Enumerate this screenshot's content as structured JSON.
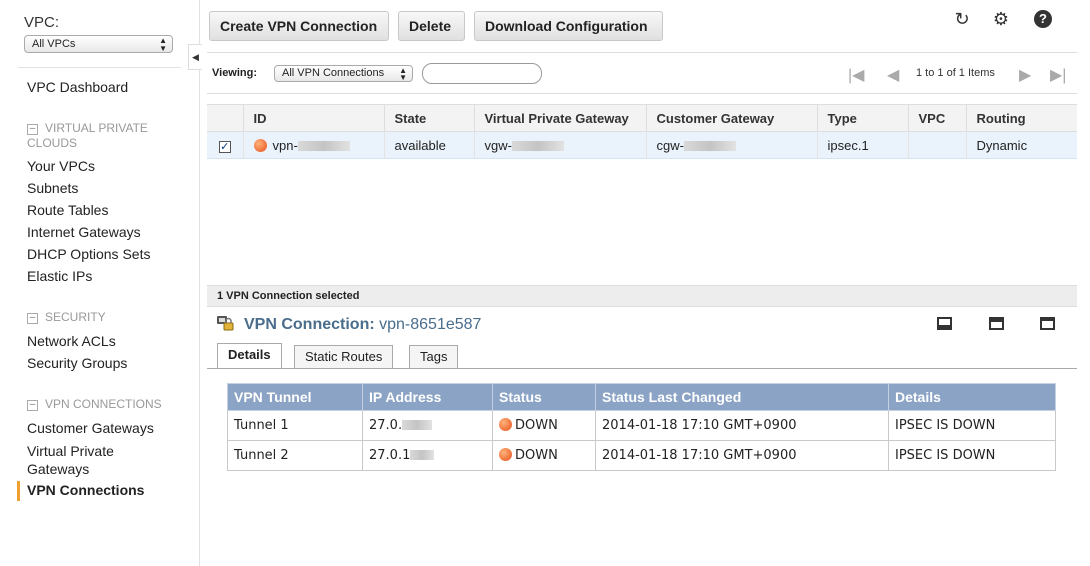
{
  "sidebar": {
    "vpc_label": "VPC:",
    "vpc_select": "All VPCs",
    "dashboard": "VPC Dashboard",
    "sections": [
      {
        "title": "VIRTUAL PRIVATE CLOUDS",
        "items": [
          "Your VPCs",
          "Subnets",
          "Route Tables",
          "Internet Gateways",
          "DHCP Options Sets",
          "Elastic IPs"
        ]
      },
      {
        "title": "SECURITY",
        "items": [
          "Network ACLs",
          "Security Groups"
        ]
      },
      {
        "title": "VPN CONNECTIONS",
        "items": [
          "Customer Gateways",
          "Virtual Private Gateways",
          "VPN Connections"
        ]
      }
    ],
    "active_item": "VPN Connections"
  },
  "toolbar": {
    "create": "Create VPN Connection",
    "delete": "Delete",
    "download": "Download Configuration",
    "icons": [
      "refresh-icon",
      "gear-icon",
      "help-icon"
    ]
  },
  "viewbar": {
    "viewing_label": "Viewing:",
    "viewing_select": "All VPN Connections",
    "search_value": "",
    "pager_text": "1 to 1 of 1 Items"
  },
  "table": {
    "columns": [
      "ID",
      "State",
      "Virtual Private Gateway",
      "Customer Gateway",
      "Type",
      "VPC",
      "Routing"
    ],
    "rows": [
      {
        "checked": true,
        "id": "vpn-",
        "state": "available",
        "vgw": "vgw-",
        "cgw": "cgw-",
        "type": "ipsec.1",
        "vpc": "",
        "routing": "Dynamic"
      }
    ]
  },
  "detail": {
    "selected_text": "1 VPN Connection selected",
    "title_label": "VPN Connection:",
    "title_id": "vpn-8651e587",
    "tabs": [
      "Details",
      "Static Routes",
      "Tags"
    ],
    "active_tab": "Details",
    "tunnel_columns": [
      "VPN Tunnel",
      "IP Address",
      "Status",
      "Status Last Changed",
      "Details"
    ],
    "tunnels": [
      {
        "name": "Tunnel 1",
        "ip": "27.0.",
        "status": "DOWN",
        "changed": "2014-01-18 17:10 GMT+0900",
        "details": "IPSEC IS DOWN"
      },
      {
        "name": "Tunnel 2",
        "ip": "27.0.1",
        "status": "DOWN",
        "changed": "2014-01-18 17:10 GMT+0900",
        "details": "IPSEC IS DOWN"
      }
    ]
  }
}
